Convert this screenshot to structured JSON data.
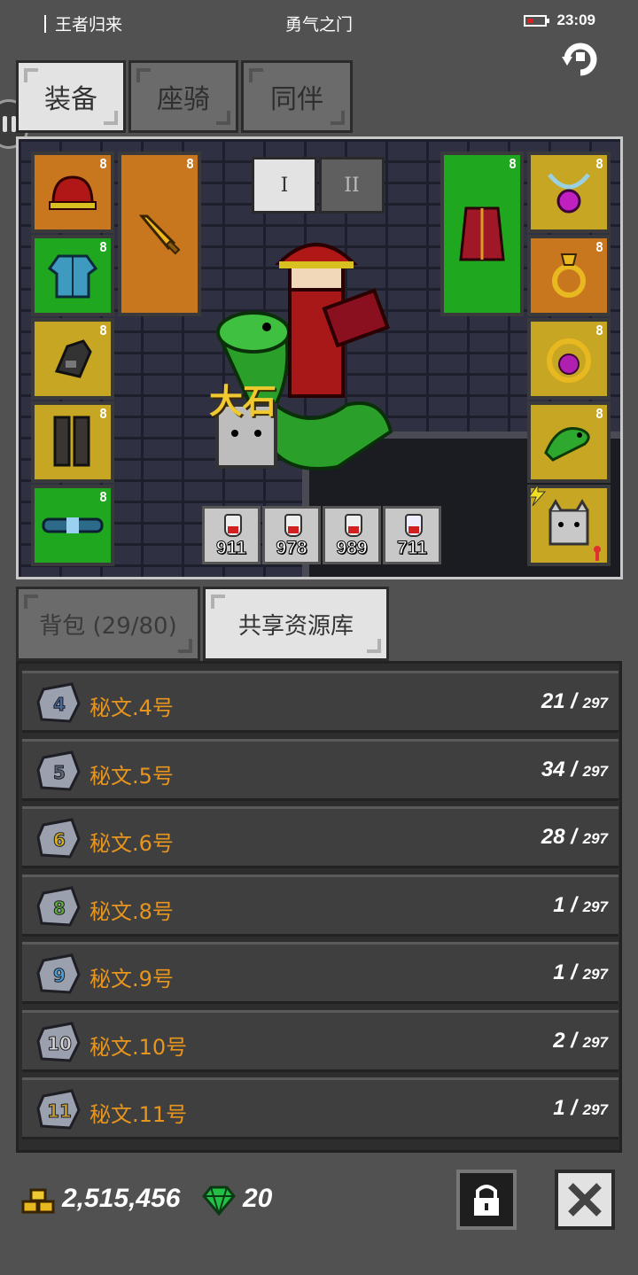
{
  "status_bar": {
    "left_text": "王者归来",
    "center_text": "勇气之门",
    "time": "23:09"
  },
  "top_tabs": [
    {
      "label": "装备",
      "active": true
    },
    {
      "label": "座骑",
      "active": false
    },
    {
      "label": "同伴",
      "active": false
    }
  ],
  "scene": {
    "segments": [
      {
        "label": "I",
        "active": true
      },
      {
        "label": "II",
        "active": false
      }
    ],
    "character_name": "大石",
    "slot_lock_mark": "8",
    "potions": [
      "911",
      "978",
      "989",
      "711"
    ],
    "left_slots": [
      {
        "item": "red-helmet",
        "color": "orange"
      },
      {
        "item": "blue-armor",
        "color": "green"
      },
      {
        "item": "gauntlet",
        "color": "yellow"
      },
      {
        "item": "boots",
        "color": "yellow"
      },
      {
        "item": "belt",
        "color": "green"
      }
    ],
    "right_slots": [
      {
        "item": "necklace",
        "color": "yellow"
      },
      {
        "item": "ring",
        "color": "orange"
      },
      {
        "item": "amulet",
        "color": "yellow"
      },
      {
        "item": "snake-pet",
        "color": "yellow"
      },
      {
        "item": "cat-companion",
        "color": "yellow"
      }
    ]
  },
  "bottom_tabs": [
    {
      "label": "背包 (29/80)",
      "active": false
    },
    {
      "label": "共享资源库",
      "active": true
    }
  ],
  "resources": [
    {
      "name": "秘文.4号",
      "count": "21",
      "max": "297",
      "rune_num": "4",
      "rune_color": "#4a6a9a"
    },
    {
      "name": "秘文.5号",
      "count": "34",
      "max": "297",
      "rune_num": "5",
      "rune_color": "#5c6878"
    },
    {
      "name": "秘文.6号",
      "count": "28",
      "max": "297",
      "rune_num": "6",
      "rune_color": "#d6b020"
    },
    {
      "name": "秘文.8号",
      "count": "1",
      "max": "297",
      "rune_num": "8",
      "rune_color": "#5fae3c"
    },
    {
      "name": "秘文.9号",
      "count": "1",
      "max": "297",
      "rune_num": "9",
      "rune_color": "#4aa0d8"
    },
    {
      "name": "秘文.10号",
      "count": "2",
      "max": "297",
      "rune_num": "10",
      "rune_color": "#d8d8d8"
    },
    {
      "name": "秘文.11号",
      "count": "1",
      "max": "297",
      "rune_num": "11",
      "rune_color": "#c8a030"
    }
  ],
  "footer": {
    "gold": "2,515,456",
    "gems": "20"
  },
  "colors": {
    "slot_orange": "#c9771f",
    "slot_green": "#1fa71f",
    "slot_yellow": "#c7a624",
    "resource_name": "#e8951e"
  }
}
